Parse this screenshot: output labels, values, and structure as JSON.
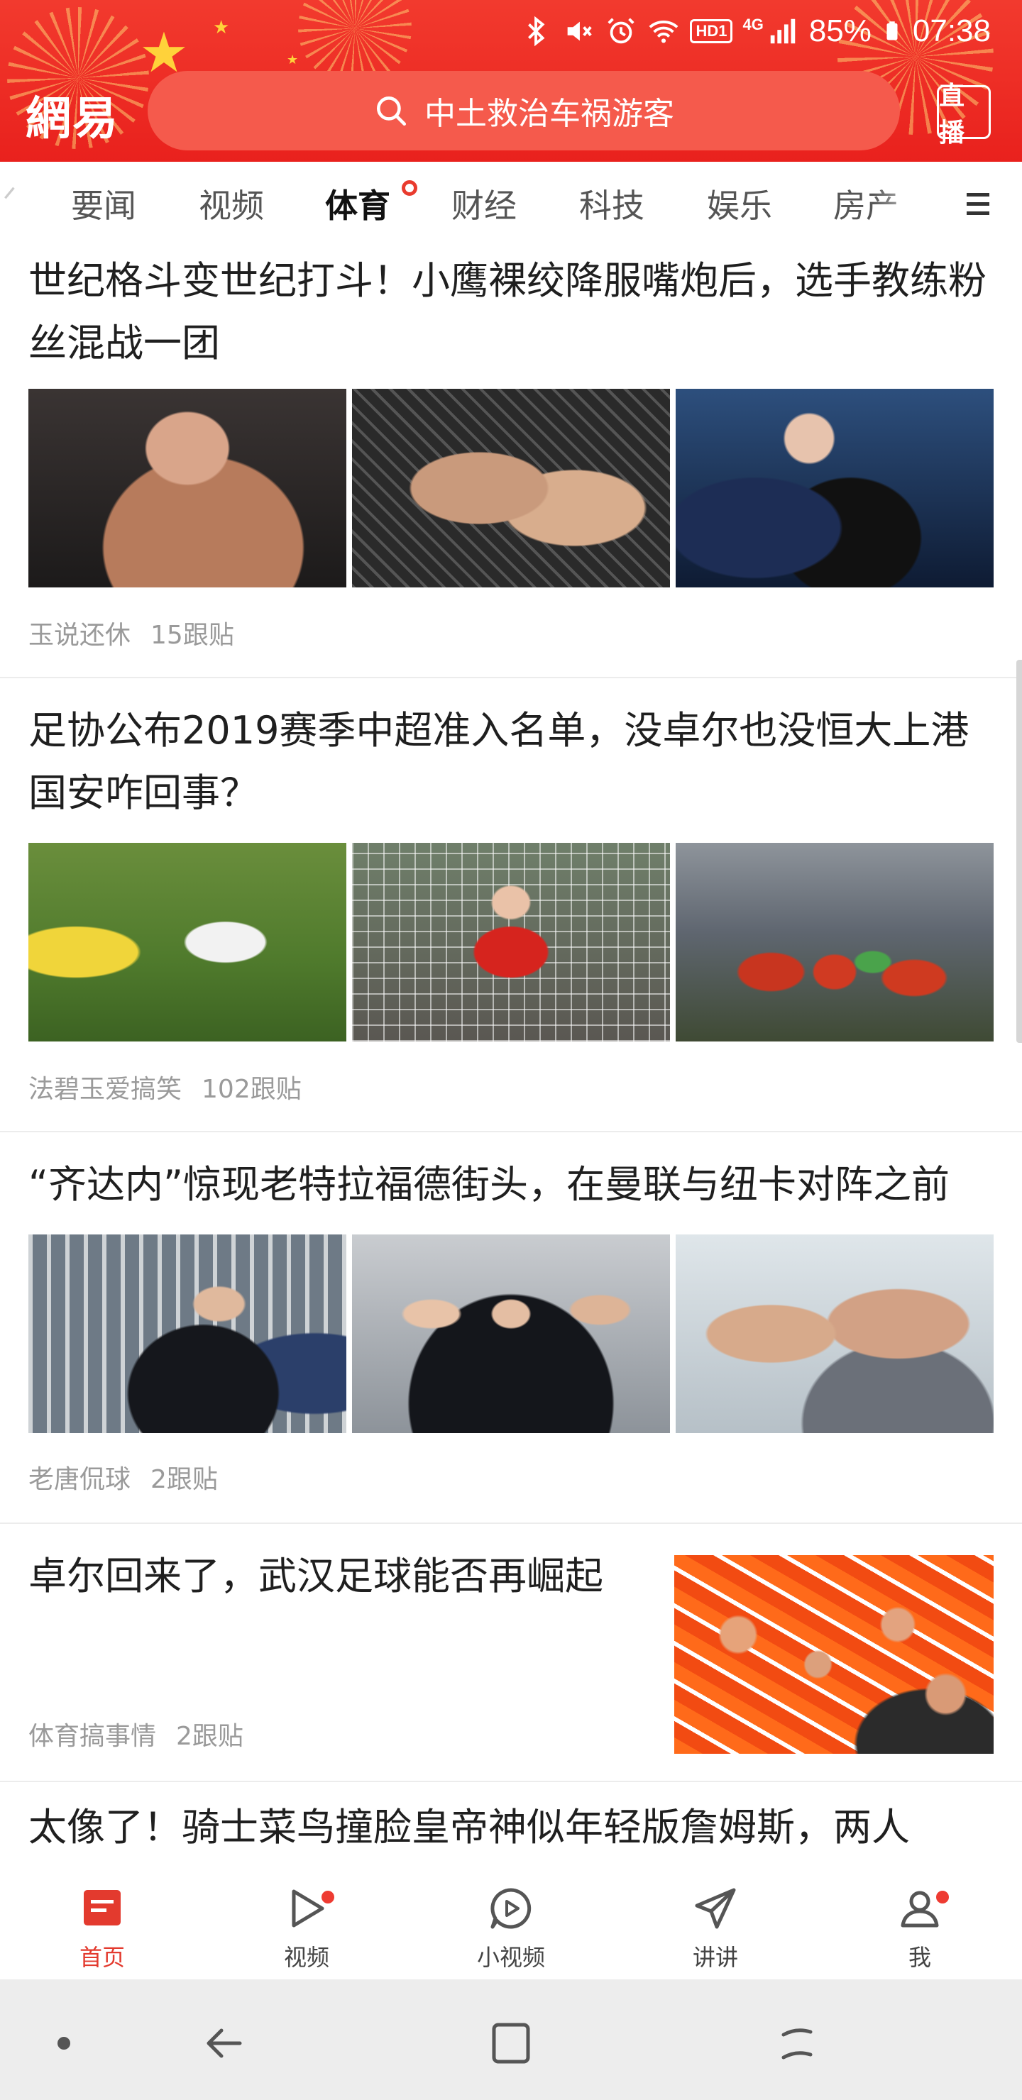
{
  "status_bar": {
    "battery_percent": "85%",
    "time": "07:38",
    "icons": [
      "bluetooth-icon",
      "mute-icon",
      "alarm-icon",
      "wifi-icon",
      "hd-icon",
      "signal-4g-icon",
      "battery-icon"
    ],
    "hd_label": "HD1",
    "network_label": "4G"
  },
  "header": {
    "logo": "網易",
    "search_text": "中土救治车祸游客",
    "live_label": "直播",
    "accent_color": "#e9211d"
  },
  "channels": {
    "tabs": [
      {
        "label": "要闻",
        "active": false
      },
      {
        "label": "视频",
        "active": false
      },
      {
        "label": "体育",
        "active": true
      },
      {
        "label": "财经",
        "active": false
      },
      {
        "label": "科技",
        "active": false
      },
      {
        "label": "娱乐",
        "active": false
      },
      {
        "label": "房产",
        "active": false
      }
    ]
  },
  "feed": {
    "articles": [
      {
        "title": "世纪格斗变世纪打斗！小鹰裸绞降服嘴炮后，选手教练粉丝混战一团",
        "source": "玉说还休",
        "comments": "15跟贴",
        "thumbnails": [
          "ufa-press-conference-photo",
          "octagon-grappling-photo",
          "ufc-stage-confrontation-photo"
        ]
      },
      {
        "title": "足协公布2019赛季中超准入名单，没卓尔也没恒大上港国安咋回事？",
        "source": "法碧玉爱搞笑",
        "comments": "102跟贴",
        "thumbnails": [
          "youth-football-photo",
          "goal-net-model-photo",
          "stadium-team-photo"
        ]
      },
      {
        "title": "“齐达内”惊现老特拉福德街头，在曼联与纽卡对阵之前",
        "source": "老唐侃球",
        "comments": "2跟贴",
        "thumbnails": [
          "street-fans-photo",
          "selfie-crowd-photo",
          "coaches-closeup-photo"
        ]
      },
      {
        "title": "卓尔回来了，武汉足球能否再崛起",
        "source": "体育搞事情",
        "comments": "2跟贴",
        "thumbnails": [
          "orange-fans-stand-photo"
        ]
      },
      {
        "title": "太像了！骑士菜鸟撞脸皇帝神似年轻版詹姆斯，两人"
      }
    ]
  },
  "bottom_nav": {
    "items": [
      {
        "label": "首页",
        "icon": "home-news-icon",
        "active": true,
        "badge": false
      },
      {
        "label": "视频",
        "icon": "video-play-icon",
        "active": false,
        "badge": true
      },
      {
        "label": "小视频",
        "icon": "short-video-icon",
        "active": false,
        "badge": false
      },
      {
        "label": "讲讲",
        "icon": "send-icon",
        "active": false,
        "badge": false
      },
      {
        "label": "我",
        "icon": "profile-icon",
        "active": false,
        "badge": true
      }
    ]
  },
  "system_nav": {
    "buttons": [
      "dot-icon",
      "back-icon",
      "recents-icon",
      "home-icon"
    ]
  }
}
